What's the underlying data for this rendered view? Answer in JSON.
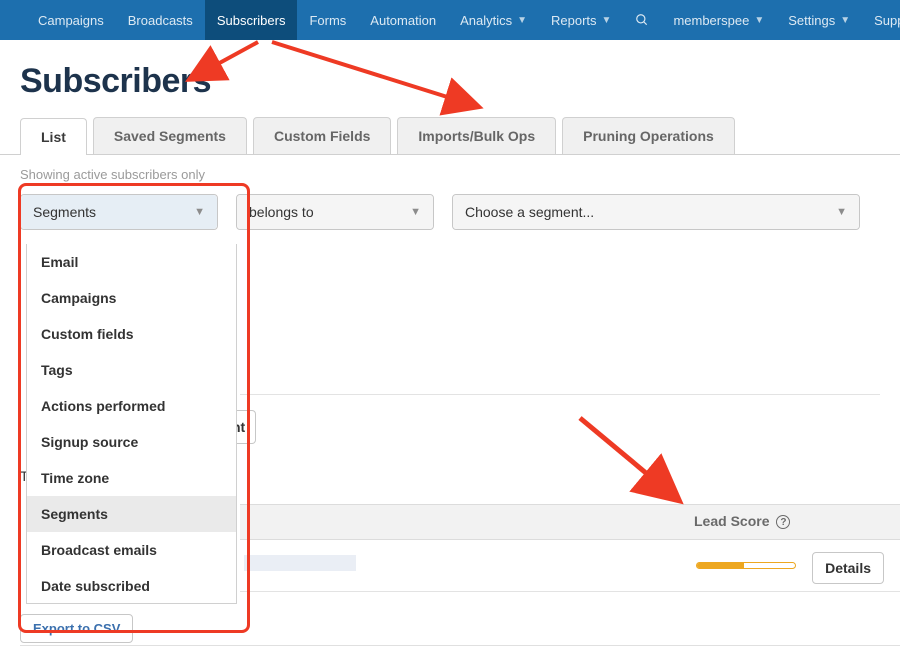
{
  "nav": {
    "items": [
      {
        "label": "Campaigns",
        "caret": false,
        "active": false
      },
      {
        "label": "Broadcasts",
        "caret": false,
        "active": false
      },
      {
        "label": "Subscribers",
        "caret": false,
        "active": true
      },
      {
        "label": "Forms",
        "caret": false,
        "active": false
      },
      {
        "label": "Automation",
        "caret": false,
        "active": false
      },
      {
        "label": "Analytics",
        "caret": true,
        "active": false
      },
      {
        "label": "Reports",
        "caret": true,
        "active": false
      }
    ],
    "right": [
      {
        "label": "memberspee",
        "caret": true
      },
      {
        "label": "Settings",
        "caret": true
      },
      {
        "label": "Support",
        "caret": true
      }
    ]
  },
  "page": {
    "title": "Subscribers",
    "meta": "Showing active subscribers only",
    "th_prefix": "Th"
  },
  "tabs": [
    {
      "label": "List",
      "active": true
    },
    {
      "label": "Saved Segments",
      "active": false
    },
    {
      "label": "Custom Fields",
      "active": false
    },
    {
      "label": "Imports/Bulk Ops",
      "active": false
    },
    {
      "label": "Pruning Operations",
      "active": false
    }
  ],
  "filters": {
    "field": {
      "selected": "Segments"
    },
    "op": {
      "selected": "belongs to"
    },
    "value": {
      "selected": "Choose a segment..."
    }
  },
  "dropdown": {
    "options": [
      "Email",
      "Campaigns",
      "Custom fields",
      "Tags",
      "Actions performed",
      "Signup source",
      "Time zone",
      "Segments",
      "Broadcast emails",
      "Date subscribed"
    ],
    "selected": "Segments"
  },
  "table": {
    "lead_score_label": "Lead Score",
    "details_label": "Details",
    "mid_button_frag": "nt"
  },
  "buttons": {
    "export": "Export to CSV"
  },
  "colors": {
    "annotation": "#ee3a24",
    "lead_bar": "#eda720",
    "nav_bg": "#1d6fae"
  }
}
